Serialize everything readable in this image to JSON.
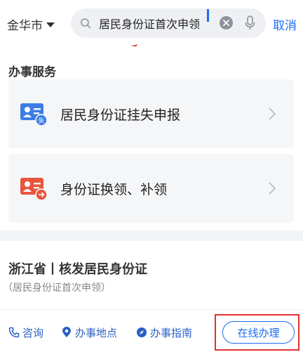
{
  "header": {
    "city": "金华市",
    "search": {
      "value": "居民身份证首次申领"
    },
    "cancel_label": "取消"
  },
  "services": {
    "title": "办事服务",
    "items": [
      {
        "label": "居民身份证挂失申报",
        "icon": "id-card-report-icon",
        "badge": "失",
        "color": "#3d7de8"
      },
      {
        "label": "身份证换领、补领",
        "icon": "id-card-renew-icon",
        "color": "#e8553d"
      }
    ]
  },
  "result": {
    "title": "浙江省丨核发居民身份证",
    "subtitle": "（居民身份证首次申领）",
    "actions": [
      {
        "label": "咨询",
        "icon": "phone-icon"
      },
      {
        "label": "办事地点",
        "icon": "location-pin-icon"
      },
      {
        "label": "办事指南",
        "icon": "compass-icon"
      }
    ],
    "online_label": "在线办理"
  },
  "colors": {
    "accent": "#1b6cf2",
    "annotation": "#e03131"
  }
}
